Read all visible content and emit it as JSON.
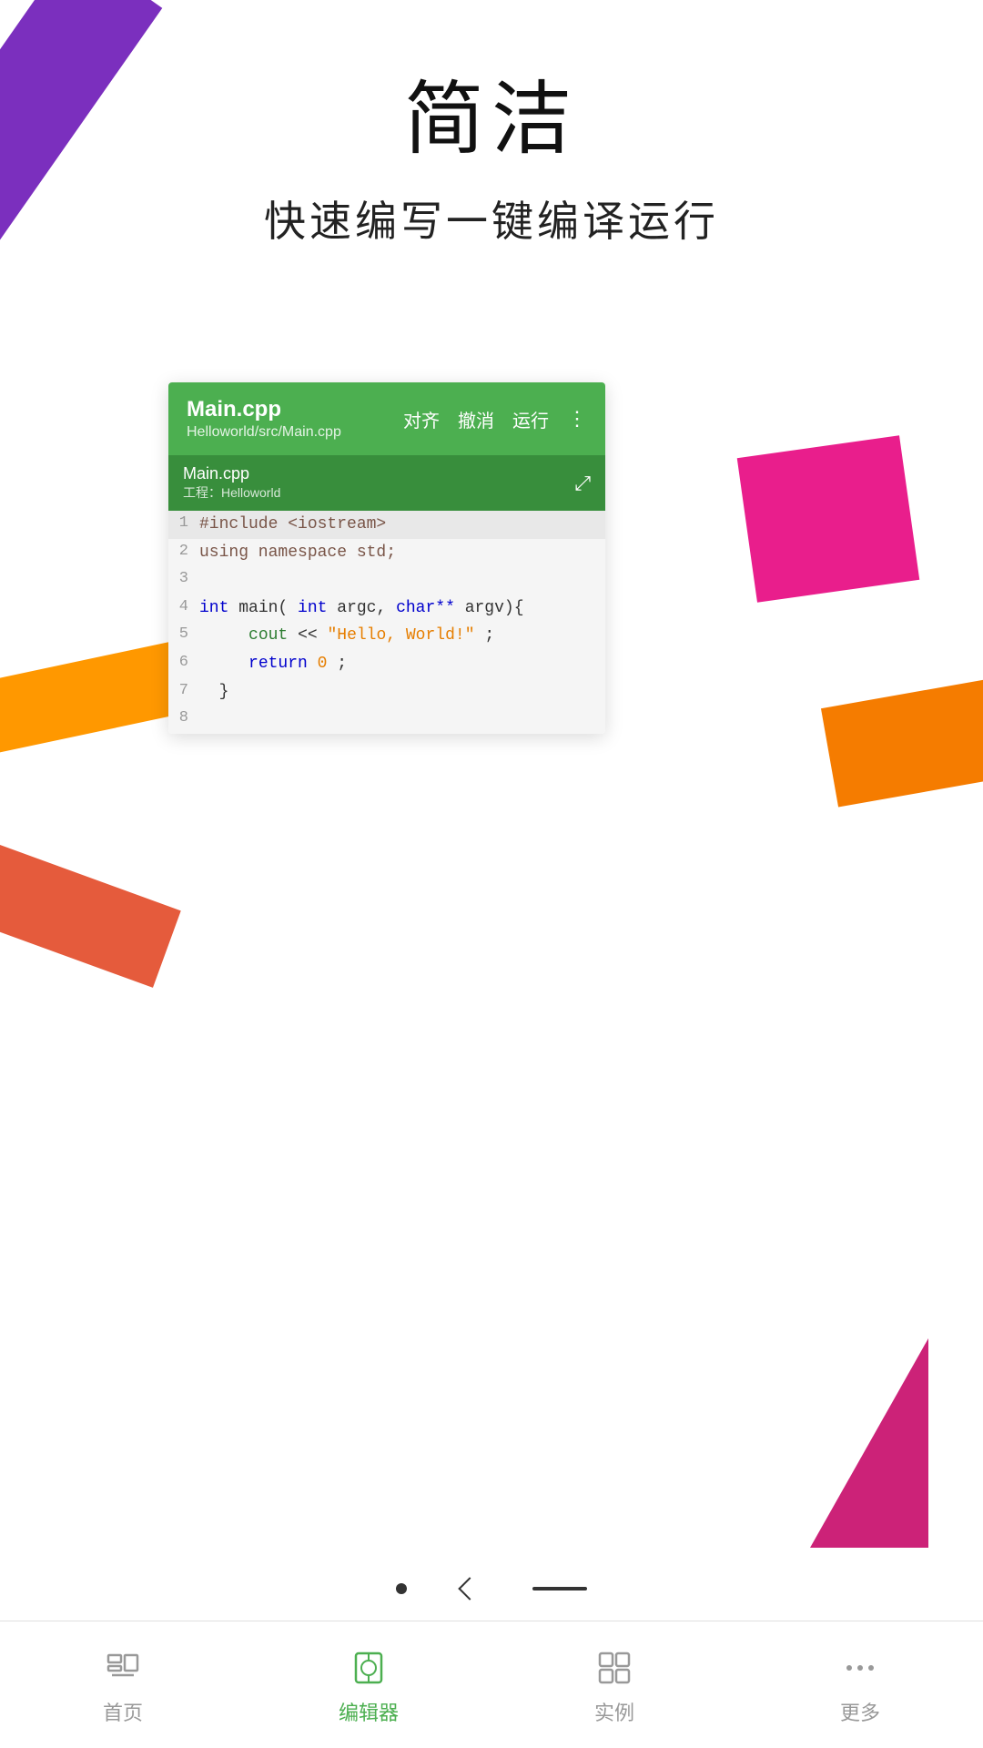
{
  "header": {
    "main_title": "简洁",
    "sub_title": "快速编写一键编译运行"
  },
  "editor": {
    "filename": "Main.cpp",
    "filepath": "Helloworld/src/Main.cpp",
    "tab_filename": "Main.cpp",
    "tab_project": "工程：Helloworld",
    "actions": {
      "align": "对齐",
      "undo": "撤消",
      "run": "运行"
    },
    "code_lines": [
      {
        "num": "1",
        "content": "#include <iostream>"
      },
      {
        "num": "2",
        "content": "using namespace std;"
      },
      {
        "num": "3",
        "content": ""
      },
      {
        "num": "4",
        "content": "int  main(int argc, char** argv){"
      },
      {
        "num": "5",
        "content": "    cout << \"Hello, World!\";"
      },
      {
        "num": "6",
        "content": "    return 0;"
      },
      {
        "num": "7",
        "content": "  }"
      },
      {
        "num": "8",
        "content": ""
      }
    ]
  },
  "bottom_nav": {
    "items": [
      {
        "id": "home",
        "label": "首页",
        "active": false
      },
      {
        "id": "editor",
        "label": "编辑器",
        "active": true
      },
      {
        "id": "examples",
        "label": "实例",
        "active": false
      },
      {
        "id": "more",
        "label": "更多",
        "active": false
      }
    ]
  }
}
